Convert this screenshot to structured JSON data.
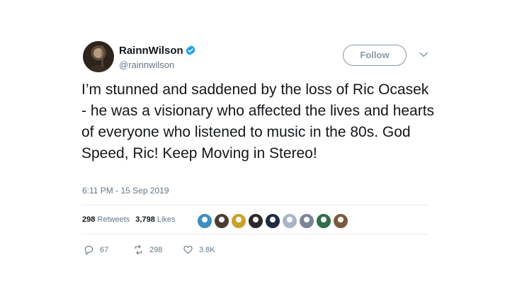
{
  "tweet": {
    "display_name": "RainnWilson",
    "handle": "@rainnwilson",
    "verified": true,
    "follow_label": "Follow",
    "text": "I’m stunned and saddened by the loss of Ric Ocasek - he was a visionary who affected the lives and hearts of everyone who listened to music in the 80s. God Speed, Ric! Keep Moving in Stereo!",
    "timestamp": "6:11 PM - 15 Sep 2019"
  },
  "stats": {
    "retweets_count": "298",
    "retweets_label": "Retweets",
    "likes_count": "3,798",
    "likes_label": "Likes"
  },
  "liker_avatars": [
    {
      "icon": "avatar-1",
      "color": "#3b8fbf"
    },
    {
      "icon": "avatar-2",
      "color": "#4a3c33"
    },
    {
      "icon": "avatar-3",
      "color": "#c9a227"
    },
    {
      "icon": "avatar-4",
      "color": "#2a2a2a"
    },
    {
      "icon": "avatar-5",
      "color": "#1f2a44"
    },
    {
      "icon": "avatar-6",
      "color": "#a9b6c9"
    },
    {
      "icon": "avatar-7",
      "color": "#7a8595"
    },
    {
      "icon": "avatar-8",
      "color": "#2f6e4a"
    },
    {
      "icon": "avatar-9",
      "color": "#7b5a3c"
    }
  ],
  "actions": {
    "replies": "67",
    "retweets": "298",
    "likes": "3.8K"
  },
  "colors": {
    "text": "#14171a",
    "secondary": "#657786",
    "verified": "#1da1f2",
    "border": "#e6ecf0"
  }
}
